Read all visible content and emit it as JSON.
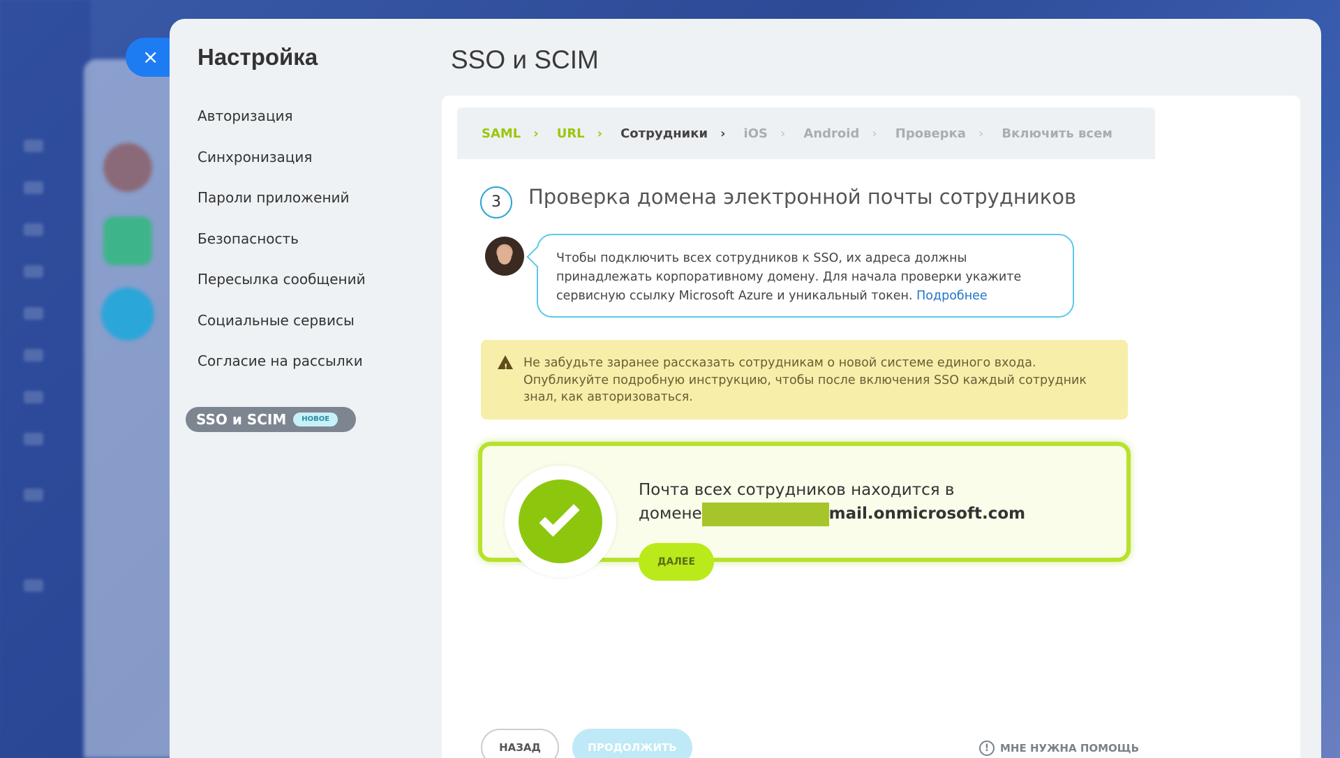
{
  "close_icon": "×",
  "settings": {
    "title": "Настройка",
    "nav": [
      {
        "label": "Авторизация"
      },
      {
        "label": "Синхронизация"
      },
      {
        "label": "Пароли приложений"
      },
      {
        "label": "Безопасность"
      },
      {
        "label": "Пересылка сообщений"
      },
      {
        "label": "Социальные сервисы"
      },
      {
        "label": "Согласие на рассылки"
      }
    ],
    "active_item": {
      "label": "SSO и SCIM",
      "badge": "НОВОЕ"
    }
  },
  "page": {
    "title": "SSO и SCIM"
  },
  "steps": [
    {
      "label": "SAML",
      "state": "done"
    },
    {
      "label": "URL",
      "state": "done"
    },
    {
      "label": "Сотрудники",
      "state": "current"
    },
    {
      "label": "iOS",
      "state": "pending"
    },
    {
      "label": "Android",
      "state": "pending"
    },
    {
      "label": "Проверка",
      "state": "pending"
    },
    {
      "label": "Включить всем",
      "state": "pending"
    }
  ],
  "step_separator": "›",
  "section": {
    "number": "3",
    "heading": "Проверка домена электронной почты сотрудников"
  },
  "bubble": {
    "text": "Чтобы подключить всех сотрудников к SSO, их адреса должны принадлежать корпоративному домену. Для начала проверки укажите сервисную ссылку Microsoft Azure и уникальный токен. ",
    "link": "Подробнее"
  },
  "warning": {
    "icon": "!",
    "text": "Не забудьте заранее рассказать сотрудникам о новой системе единого входа. Опубликуйте подробную инструкцию, чтобы после включения SSO каждый сотрудник знал, как авторизоваться."
  },
  "success": {
    "line1": "Почта всех сотрудников находится в",
    "line2_prefix": "домене",
    "domain_suffix": "mail.onmicrosoft.com",
    "next_button": "ДАЛЕЕ"
  },
  "footer": {
    "back_button": "НАЗАД",
    "continue_button": "ПРОДОЛЖИТЬ",
    "help_icon": "!",
    "help_text": "МНЕ НУЖНА ПОМОЩЬ"
  },
  "colors": {
    "accent_green": "#9bc60a",
    "link_blue": "#2375c8",
    "close_blue": "#1e7cf2"
  }
}
